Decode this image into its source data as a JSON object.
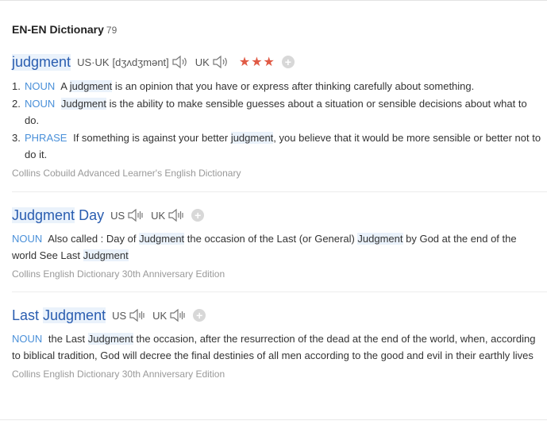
{
  "dictionary": {
    "title": "EN-EN Dictionary",
    "count": "79"
  },
  "entries": [
    {
      "headword": "judgment",
      "us_uk_label": "US·UK",
      "phonetic": "[dʒʌdʒmənt]",
      "uk_label": "UK",
      "stars": "★★★",
      "definitions": [
        {
          "num": "1.",
          "pos": "NOUN",
          "pre": "A ",
          "hl": "judgment",
          "post": " is an opinion that you have or express after thinking carefully about something."
        },
        {
          "num": "2.",
          "pos": "NOUN",
          "pre": "",
          "hl": "Judgment",
          "post": " is the ability to make sensible guesses about a situation or sensible decisions about what to do."
        },
        {
          "num": "3.",
          "pos": "PHRASE",
          "pre": "If something is against your better ",
          "hl": "judgment",
          "post": ", you believe that it would be more sensible or better not to do it."
        }
      ],
      "source": "Collins Cobuild Advanced Learner's English Dictionary"
    },
    {
      "headword_hl": "Judgment",
      "headword_rest": " Day",
      "us_label": "US",
      "uk_label": "UK",
      "pos": "NOUN",
      "t1": "Also called : Day of ",
      "h1": "Judgment",
      "t2": " the occasion of the Last (or General) ",
      "h2": "Judgment",
      "t3": " by God at the end of the world See Last ",
      "h3": "Judgment",
      "source": "Collins English Dictionary 30th Anniversary Edition"
    },
    {
      "headword_pre": "Last ",
      "headword_hl": "Judgment",
      "us_label": "US",
      "uk_label": "UK",
      "pos": "NOUN",
      "t1": "the Last ",
      "h1": "Judgment",
      "t2": " the occasion, after the resurrection of the dead at the end of the world, when, according to biblical tradition, God will decree the final destinies of all men according to the good and evil in their earthly lives",
      "source": "Collins English Dictionary 30th Anniversary Edition"
    }
  ],
  "colors": {
    "headword": "#2a5db0",
    "pos": "#4a90d9",
    "stars": "#e05a45",
    "highlight": "#eaf2fb",
    "source": "#999999"
  },
  "icons": {
    "audio": "speaker-icon",
    "add": "plus-icon",
    "rating": "star-icon"
  }
}
